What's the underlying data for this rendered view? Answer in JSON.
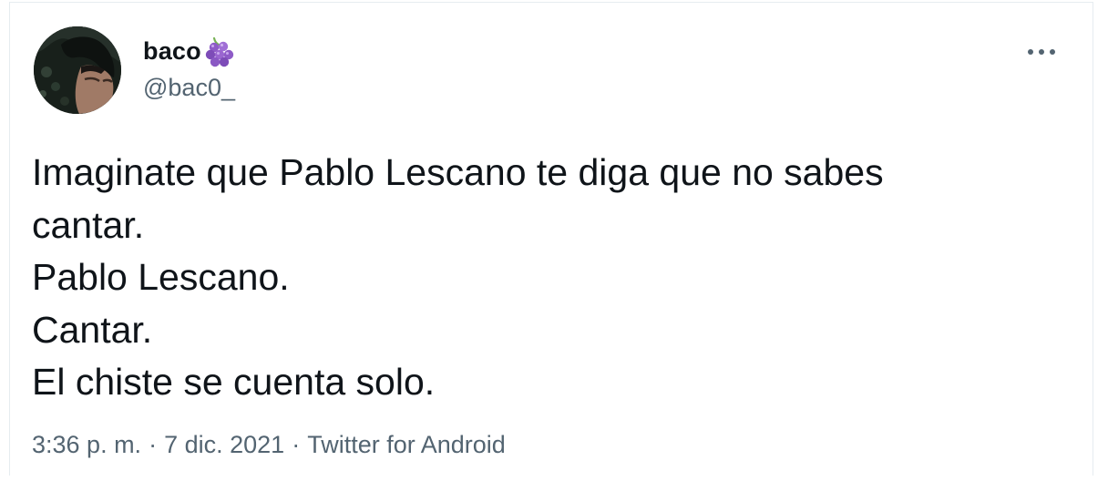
{
  "tweet": {
    "author": {
      "display_name": "baco",
      "name_emoji_icon": "grapes-icon",
      "handle": "@bac0_"
    },
    "more_icon": "more-horizontal-icon",
    "text_lines": [
      "Imaginate que Pablo Lescano te diga que no sabes",
      "cantar.",
      "Pablo Lescano.",
      "Cantar.",
      "El chiste se cuenta solo."
    ],
    "meta": {
      "time": "3:36 p. m.",
      "separator": "·",
      "date": "7 dic. 2021",
      "source": "Twitter for Android"
    }
  },
  "colors": {
    "text_primary": "#0f1419",
    "text_secondary": "#536471",
    "border": "#e6ecf0",
    "grape_purple": "#8e5bc7",
    "grape_stem": "#77b255"
  }
}
